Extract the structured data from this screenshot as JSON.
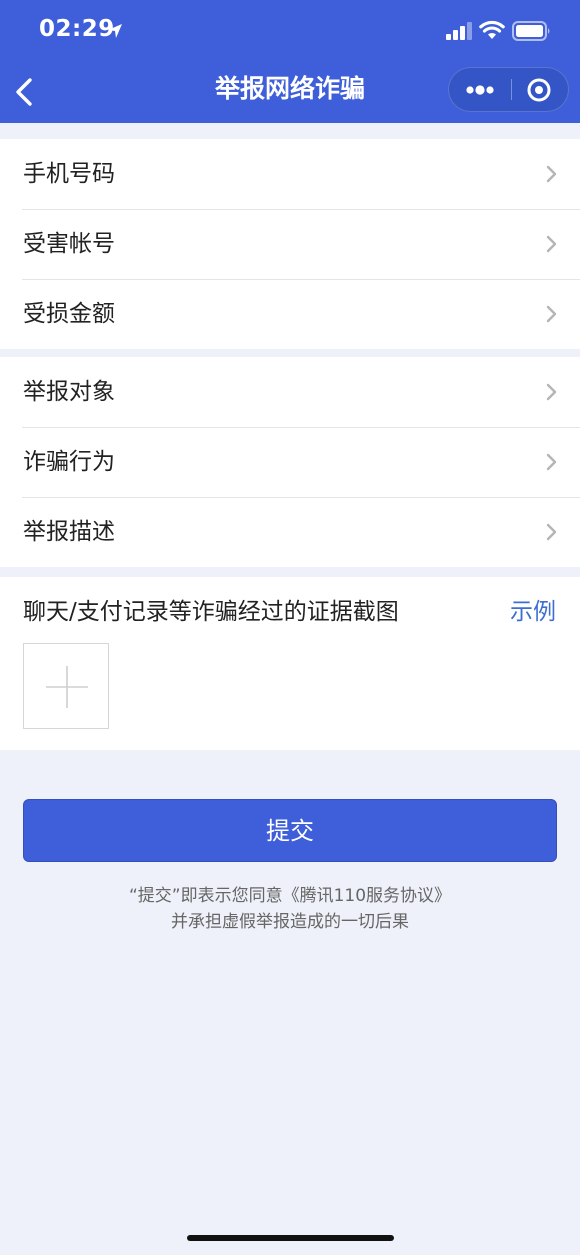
{
  "status_bar": {
    "time": "02:29"
  },
  "nav": {
    "title": "举报网络诈骗"
  },
  "colors": {
    "brand": "#3e5fd9",
    "link": "#3e6fd0",
    "background": "#eef1f9"
  },
  "group1": {
    "items": [
      {
        "label": "手机号码"
      },
      {
        "label": "受害帐号"
      },
      {
        "label": "受损金额"
      }
    ]
  },
  "group2": {
    "items": [
      {
        "label": "举报对象"
      },
      {
        "label": "诈骗行为"
      },
      {
        "label": "举报描述"
      }
    ]
  },
  "evidence": {
    "label": "聊天/支付记录等诈骗经过的证据截图",
    "example_link": "示例"
  },
  "submit": {
    "label": "提交"
  },
  "agreement": {
    "prefix": "“提交”即表示您同意",
    "link": "《腾讯110服务协议》",
    "line2": "并承担虚假举报造成的一切后果"
  },
  "icons": {
    "back": "chevron-left-icon",
    "more": "more-dots-icon",
    "close": "target-circle-icon",
    "row_arrow": "chevron-right-icon",
    "upload": "plus-icon"
  }
}
